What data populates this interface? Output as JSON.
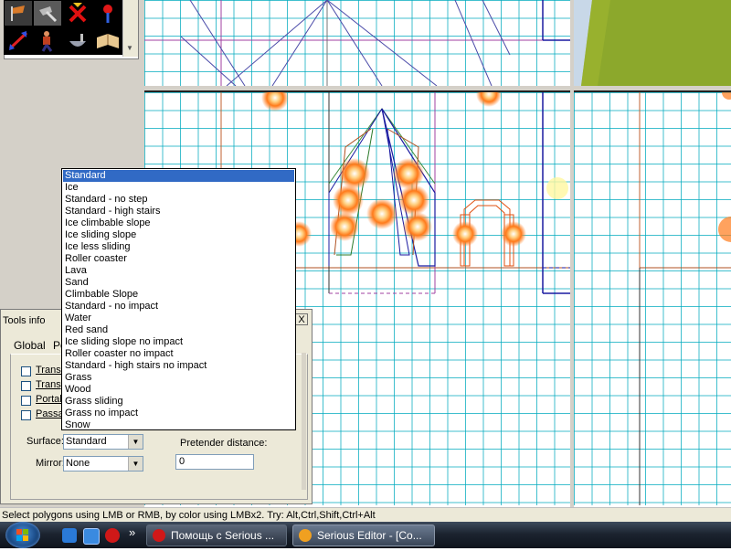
{
  "status_bar": {
    "text": "Select polygons using LMB or RMB, by color using LMBx2. Try: Alt,Ctrl,Shift,Ctrl+Alt"
  },
  "tools_info": {
    "title": "Tools info",
    "close_glyph": "X",
    "tabs": [
      "Global",
      "Po"
    ],
    "checkboxes": [
      {
        "label": "Transl",
        "checked": false
      },
      {
        "label": "Transp",
        "checked": false
      },
      {
        "label": "Portal",
        "checked": false
      },
      {
        "label": "Passa",
        "checked": false
      }
    ],
    "surface_label": "Surface:",
    "surface_value": "Standard",
    "mirror_label": "Mirror:",
    "mirror_value": "None",
    "pretender_label": "Pretender distance:",
    "pretender_value": "0"
  },
  "surface_dropdown": {
    "selected_index": 0,
    "options": [
      "Standard",
      "Ice",
      "Standard - no step",
      "Standard - high stairs",
      "Ice climbable slope",
      "Ice sliding slope",
      "Ice less sliding",
      "Roller coaster",
      "Lava",
      "Sand",
      "Climbable Slope",
      "Standard - no impact",
      "Water",
      "Red sand",
      "Ice sliding slope no impact",
      "Roller coaster no impact",
      "Standard - high stairs no impact",
      "Grass",
      "Wood",
      "Grass sliding",
      "Grass no impact",
      "Snow"
    ]
  },
  "taskbar": {
    "overflow_glyph": "»",
    "tasks": [
      {
        "label": "Помощь с Serious ...",
        "active": false
      },
      {
        "label": "Serious Editor - [Co...",
        "active": true
      }
    ]
  },
  "colors": {
    "selection": "#316ac5",
    "grid": "#00aabe",
    "ground": "#8ca82c",
    "light_glow": "#ff7a1a"
  },
  "icons": {
    "toolbox": [
      "flag-tool-icon",
      "hammer-tool-icon",
      "red-x-icon",
      "blue-pin-icon",
      "rotate-arrow-icon",
      "character-icon",
      "bowl-icon",
      "book-icon"
    ],
    "quick_launch": [
      "ie-icon",
      "explorer-icon",
      "opera-icon"
    ]
  }
}
